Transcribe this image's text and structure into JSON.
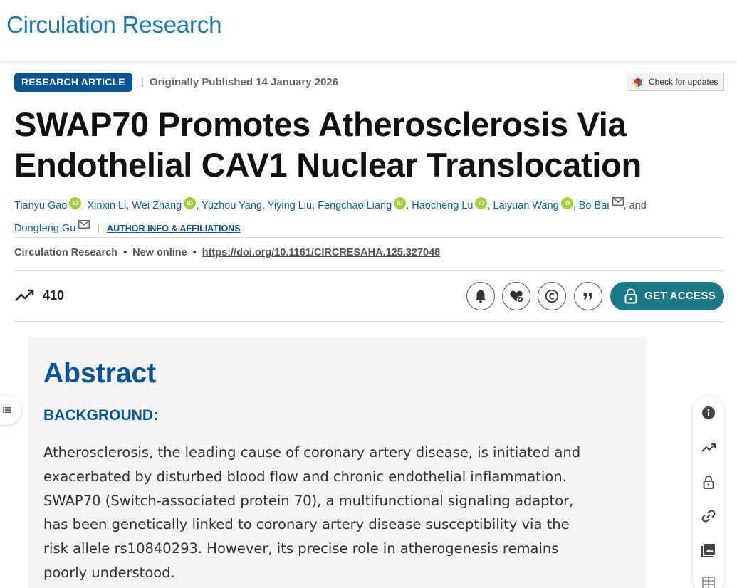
{
  "header": {
    "journal_name": "Circulation Research"
  },
  "meta": {
    "badge": "RESEARCH ARTICLE",
    "separator": "|",
    "published": "Originally Published 14 January 2026",
    "check_updates": "Check for updates"
  },
  "article": {
    "title": "SWAP70 Promotes Atherosclerosis Via Endothelial CAV1 Nuclear Translocation",
    "authors": [
      "Tianyu Gao",
      "Xinxin Li",
      "Wei Zhang",
      "Yuzhou Yang",
      "Yiying Liu",
      "Fengchao Liang",
      "Haocheng Lu",
      "Laiyuan Wang",
      "Bo Bai",
      "Dongfeng Gu"
    ],
    "and_text": ", and",
    "affiliations_link": "AUTHOR INFO & AFFILIATIONS"
  },
  "citation": {
    "journal": "Circulation Research",
    "status": "New online",
    "doi": "https://doi.org/10.1161/CIRCRESAHA.125.327048"
  },
  "metrics": {
    "count": "410",
    "icon": "trending-up-icon"
  },
  "actions": {
    "icons": [
      "bell-icon",
      "heart-plus-icon",
      "copyright-icon",
      "quote-icon"
    ],
    "get_access": "GET ACCESS"
  },
  "abstract": {
    "heading": "Abstract",
    "section": "BACKGROUND:",
    "lines": [
      "Atherosclerosis, the leading cause of coronary artery disease, is initiated and",
      "exacerbated by disturbed blood flow and chronic endothelial inflammation.",
      "SWAP70 (Switch-associated protein 70), a multifunctional signaling adaptor,",
      "has been genetically linked to coronary artery disease susceptibility via the",
      "risk allele rs10840293. However, its precise role in atherogenesis remains",
      "poorly understood."
    ]
  },
  "side_tools": [
    "info-icon",
    "trending-up-icon",
    "lock-icon",
    "link-icon",
    "images-icon",
    "table-icon"
  ],
  "colors": {
    "brand": "#1a78b8",
    "primary": "#0a5394",
    "access": "#1a7a8a",
    "orcid": "#a6ce39"
  }
}
